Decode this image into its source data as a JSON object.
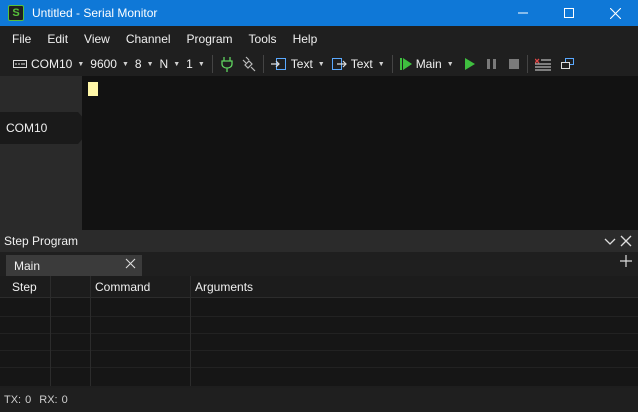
{
  "window": {
    "title": "Untitled - Serial Monitor",
    "app_icon_letter": "S"
  },
  "menu": {
    "items": [
      "File",
      "Edit",
      "View",
      "Channel",
      "Program",
      "Tools",
      "Help"
    ]
  },
  "toolbar": {
    "port": "COM10",
    "baud": "9600",
    "data_bits": "8",
    "parity": "N",
    "stop_bits": "1",
    "rx_mode": "Text",
    "tx_mode": "Text",
    "program": "Main"
  },
  "sidebar": {
    "channel": "COM10"
  },
  "step_program": {
    "title": "Step Program",
    "tab": "Main",
    "columns": [
      "Step",
      "",
      "Command",
      "Arguments"
    ]
  },
  "status": {
    "tx_label": "TX:",
    "tx_value": "0",
    "rx_label": "RX:",
    "rx_value": "0"
  },
  "colors": {
    "titlebar": "#0f78d7",
    "accent_green": "#3fbf3f",
    "cursor": "#fff7a8"
  }
}
